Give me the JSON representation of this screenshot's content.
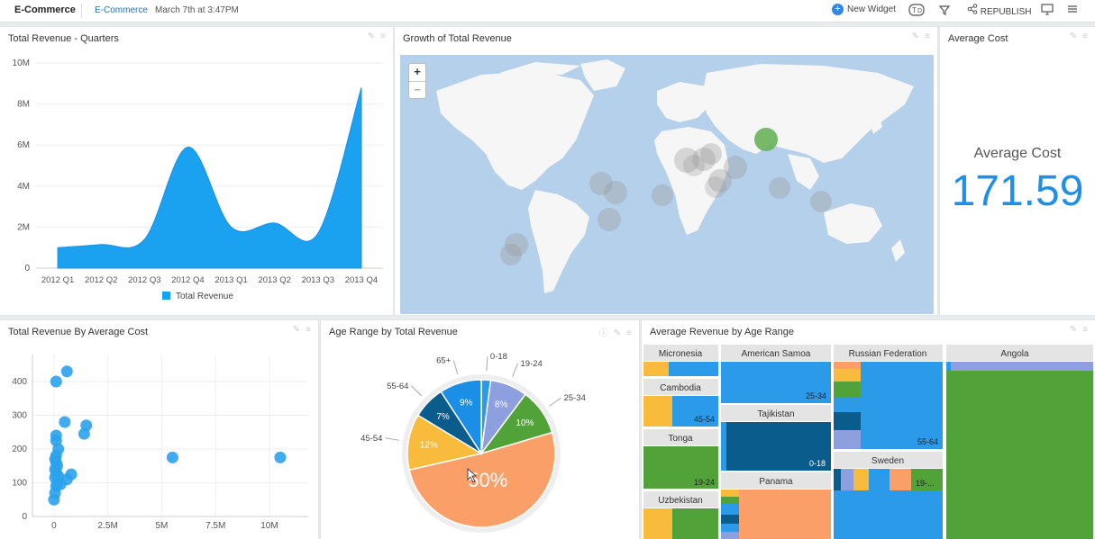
{
  "topbar": {
    "brand": "E-Commerce",
    "crumb": "E-Commerce",
    "date": "March 7th at 3:47PM",
    "new_widget": "New Widget",
    "republish": "REPUBLISH"
  },
  "panels": {
    "revenue_quarters": {
      "title": "Total Revenue - Quarters"
    },
    "growth_map": {
      "title": "Growth of Total Revenue",
      "zoom_in": "+",
      "zoom_out": "−"
    },
    "average_cost": {
      "title": "Average Cost",
      "label": "Average Cost",
      "value": "171.59"
    },
    "scatter": {
      "title": "Total Revenue By Average Cost"
    },
    "pie": {
      "title": "Age Range by Total Revenue"
    },
    "treemap": {
      "title": "Average Revenue by Age Range"
    }
  },
  "colors": {
    "accent": "#1f8fe8",
    "area": "#1aa1f0",
    "map_water": "#b5d0ea",
    "map_land": "#f6f6f6"
  },
  "chart_data": [
    {
      "type": "area",
      "categories": [
        "2012 Q1",
        "2012 Q2",
        "2012 Q3",
        "2012 Q4",
        "2013 Q1",
        "2013 Q2",
        "2013 Q3",
        "2013 Q4"
      ],
      "series": [
        {
          "name": "Total Revenue",
          "values": [
            1000000,
            1150000,
            1400000,
            5900000,
            2000000,
            2200000,
            1700000,
            8800000
          ]
        }
      ],
      "ylim": [
        0,
        10000000
      ],
      "yticks": [
        "0",
        "2M",
        "4M",
        "6M",
        "8M",
        "10M"
      ],
      "yticks_values": [
        0,
        2000000,
        4000000,
        6000000,
        8000000,
        10000000
      ],
      "legend": "bottom"
    },
    {
      "type": "scatter",
      "points": [
        {
          "x": 100000,
          "y": 400
        },
        {
          "x": 600000,
          "y": 430
        },
        {
          "x": 500000,
          "y": 280
        },
        {
          "x": 1500000,
          "y": 270
        },
        {
          "x": 1400000,
          "y": 245
        },
        {
          "x": 100000,
          "y": 240
        },
        {
          "x": 100000,
          "y": 225
        },
        {
          "x": 200000,
          "y": 200
        },
        {
          "x": 100000,
          "y": 180
        },
        {
          "x": 50000,
          "y": 170
        },
        {
          "x": 100000,
          "y": 160
        },
        {
          "x": 150000,
          "y": 150
        },
        {
          "x": 50000,
          "y": 140
        },
        {
          "x": 100000,
          "y": 130
        },
        {
          "x": 800000,
          "y": 125
        },
        {
          "x": 200000,
          "y": 120
        },
        {
          "x": 50000,
          "y": 115
        },
        {
          "x": 600000,
          "y": 110
        },
        {
          "x": 150000,
          "y": 100
        },
        {
          "x": 300000,
          "y": 95
        },
        {
          "x": 100000,
          "y": 90
        },
        {
          "x": 50000,
          "y": 70
        },
        {
          "x": 0,
          "y": 50
        },
        {
          "x": 5500000,
          "y": 175
        },
        {
          "x": 10500000,
          "y": 175
        }
      ],
      "xlim": [
        -1000000,
        11800000
      ],
      "ylim": [
        0,
        480
      ],
      "xticks": [
        "0",
        "2.5M",
        "5M",
        "7.5M",
        "10M"
      ],
      "xticks_values": [
        0,
        2500000,
        5000000,
        7500000,
        10000000
      ],
      "yticks": [
        "0",
        "100",
        "200",
        "300",
        "400"
      ],
      "yticks_values": [
        0,
        100,
        200,
        300,
        400
      ]
    },
    {
      "type": "pie",
      "slices": [
        {
          "label": "0-18",
          "value": 2,
          "color": "#2b9ae9",
          "text": ""
        },
        {
          "label": "19-24",
          "value": 8,
          "color": "#8e9fe0",
          "text": "8%"
        },
        {
          "label": "25-34",
          "value": 10,
          "color": "#52a23a",
          "text": "10%"
        },
        {
          "label": "",
          "value": 50,
          "color": "#fb9f68",
          "text": "50%"
        },
        {
          "label": "45-54",
          "value": 12,
          "color": "#f9bb3c",
          "text": "12%"
        },
        {
          "label": "55-64",
          "value": 7,
          "color": "#0a5c8c",
          "text": "7%"
        },
        {
          "label": "65+",
          "value": 9,
          "color": "#1a8fe5",
          "text": "9%"
        }
      ]
    },
    {
      "type": "heatmap",
      "groups": [
        "Micronesia",
        "American Samoa",
        "Russian Federation",
        "Angola",
        "Cambodia",
        "Tajikistan",
        "Tonga",
        "Sweden",
        "Uzbekistan",
        "Panama"
      ],
      "cell_labels": [
        "25-34",
        "45-54",
        "0-18",
        "55-64",
        "19-24",
        "19-..."
      ]
    }
  ]
}
